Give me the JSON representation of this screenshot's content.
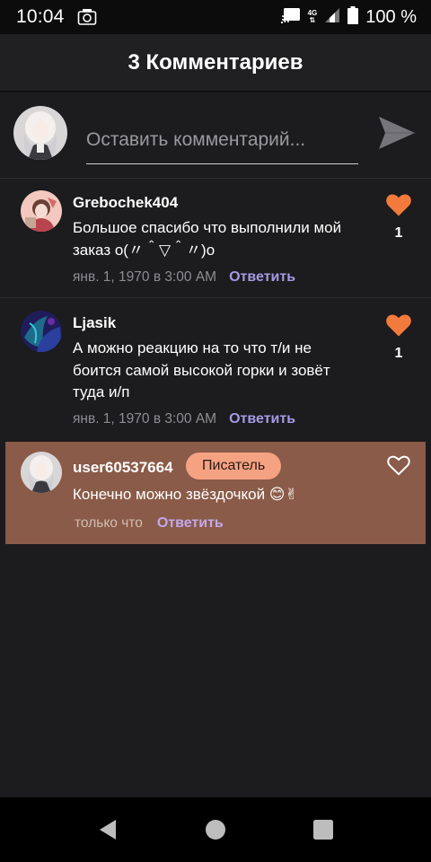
{
  "status_bar": {
    "time": "10:04",
    "network": "4G",
    "battery": "100 %"
  },
  "header": {
    "title": "3 Комментариев"
  },
  "compose": {
    "placeholder": "Оставить комментарий..."
  },
  "comments": [
    {
      "author": "Grebochek404",
      "text": "Большое спасибо что выполнили мой заказ о(〃＾▽＾〃)о",
      "time": "янв. 1, 1970 в 3:00 AM",
      "reply": "Ответить",
      "likes": "1",
      "liked": true
    },
    {
      "author": "Ljasik",
      "text": "А можно реакцию на то что т/и не боится самой высокой горки и зовёт туда и/п",
      "time": "янв. 1, 1970 в 3:00 AM",
      "reply": "Ответить",
      "likes": "1",
      "liked": true
    },
    {
      "author": "user60537664",
      "badge": "Писатель",
      "text": "Конечно можно звёздочкой 😊✌",
      "time": "только что",
      "reply": "Ответить",
      "liked": false
    }
  ],
  "colors": {
    "like_active": "#f27a3c",
    "reply_link": "#a49ae6",
    "highlight_bg": "#8a5b48",
    "badge_bg": "#f5a283"
  }
}
